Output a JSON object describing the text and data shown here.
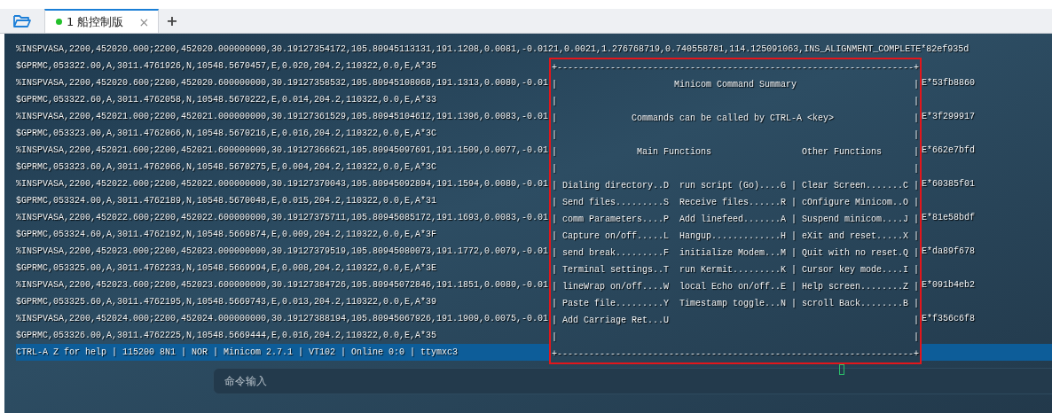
{
  "tabs": [
    {
      "label": "1 船控制版",
      "selected": true,
      "connected": true,
      "close": "×"
    }
  ],
  "new_tab": "+",
  "terminal": {
    "top_line": "%INSPVASA,2200,452020.000;2200,452020.000000000,30.19127354172,105.80945113131,191.1208,0.0081,-0.0121,0.0021,1.276768719,0.740558781,114.125091063,INS_ALIGNMENT_COMPLETE*82ef935d",
    "rows": [
      {
        "text": "$GPRMC,053322.00,A,3011.4761926,N,10548.5670457,E,0.020,204.2,110322,0.0,E,A*35"
      },
      {
        "text": "%INSPVASA,2200,452020.600;2200,452020.600000000,30.19127358532,105.80945108068,191.1313,0.0080,-0.01",
        "tail": "E*53fb8860"
      },
      {
        "text": "$GPRMC,053322.60,A,3011.4762058,N,10548.5670222,E,0.014,204.2,110322,0.0,E,A*33"
      },
      {
        "text": "%INSPVASA,2200,452021.000;2200,452021.000000000,30.19127361529,105.80945104612,191.1396,0.0083,-0.01",
        "tail": "E*3f299917"
      },
      {
        "text": "$GPRMC,053323.00,A,3011.4762066,N,10548.5670216,E,0.016,204.2,110322,0.0,E,A*3C"
      },
      {
        "text": "%INSPVASA,2200,452021.600;2200,452021.600000000,30.19127366621,105.80945097691,191.1509,0.0077,-0.01",
        "tail": "E*662e7bfd"
      },
      {
        "text": "$GPRMC,053323.60,A,3011.4762066,N,10548.5670275,E,0.004,204.2,110322,0.0,E,A*3C"
      },
      {
        "text": "%INSPVASA,2200,452022.000;2200,452022.000000000,30.19127370043,105.80945092894,191.1594,0.0080,-0.01",
        "tail": "E*60385f01"
      },
      {
        "text": "$GPRMC,053324.00,A,3011.4762189,N,10548.5670048,E,0.015,204.2,110322,0.0,E,A*31"
      },
      {
        "text": "%INSPVASA,2200,452022.600;2200,452022.600000000,30.19127375711,105.80945085172,191.1693,0.0083,-0.01",
        "tail": "E*81e58bdf"
      },
      {
        "text": "$GPRMC,053324.60,A,3011.4762192,N,10548.5669874,E,0.009,204.2,110322,0.0,E,A*3F"
      },
      {
        "text": "%INSPVASA,2200,452023.000;2200,452023.000000000,30.19127379519,105.80945080073,191.1772,0.0079,-0.01",
        "tail": "E*da89f678"
      },
      {
        "text": "$GPRMC,053325.00,A,3011.4762233,N,10548.5669994,E,0.008,204.2,110322,0.0,E,A*3E"
      },
      {
        "text": "%INSPVASA,2200,452023.600;2200,452023.600000000,30.19127384726,105.80945072846,191.1851,0.0080,-0.01",
        "tail": "E*091b4eb2"
      },
      {
        "text": "$GPRMC,053325.60,A,3011.4762195,N,10548.5669743,E,0.013,204.2,110322,0.0,E,A*39"
      },
      {
        "text": "%INSPVASA,2200,452024.000;2200,452024.000000000,30.19127388194,105.80945067926,191.1909,0.0075,-0.01",
        "tail": "E*f356c6f8"
      },
      {
        "text": "$GPRMC,053326.00,A,3011.4762225,N,10548.5669444,E,0.016,204.2,110322,0.0,E,A*35"
      }
    ],
    "help_box": {
      "highlighted": true,
      "lines": [
        "+-------------------------------------------------------------------+",
        "|                      Minicom Command Summary                      |",
        "|                                                                   |",
        "|              Commands can be called by CTRL-A <key>               |",
        "|                                                                   |",
        "|               Main Functions                 Other Functions      |",
        "|                                                                   |",
        "| Dialing directory..D  run script (Go)....G | Clear Screen.......C |",
        "| Send files.........S  Receive files......R | cOnfigure Minicom..O |",
        "| comm Parameters....P  Add linefeed.......A | Suspend minicom....J |",
        "| Capture on/off.....L  Hangup.............H | eXit and reset.....X |",
        "| send break.........F  initialize Modem...M | Quit with no reset.Q |",
        "| Terminal settings..T  run Kermit.........K | Cursor key mode....I |",
        "| lineWrap on/off....W  local Echo on/off..E | Help screen........Z |",
        "| Paste file.........Y  Timestamp toggle...N | scroll Back........B |",
        "| Add Carriage Ret...U                                              |",
        "|                                                                   |",
        "+-------------------------------------------------------------------+"
      ]
    },
    "status_bar": "CTRL-A Z for help | 115200 8N1 | NOR | Minicom 2.7.1 | VT102 | Online 0:0 | ttymxc3"
  },
  "command_input": {
    "placeholder": "命令输入"
  }
}
